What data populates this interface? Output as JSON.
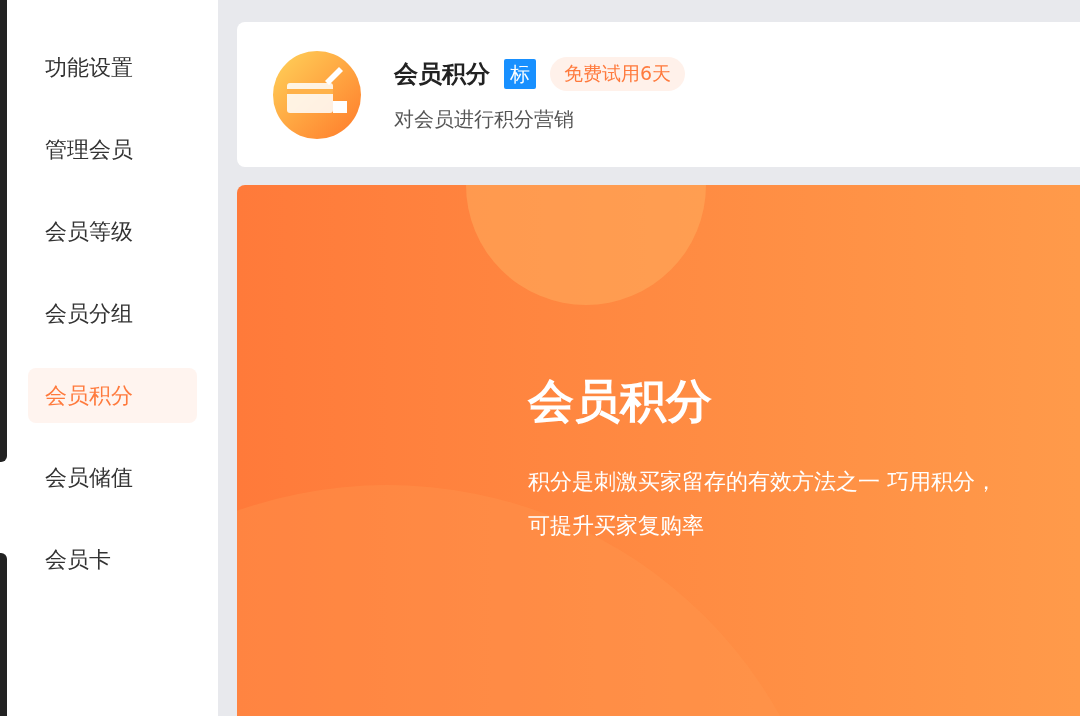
{
  "sidebar": {
    "items": [
      {
        "label": "功能设置",
        "selected": false
      },
      {
        "label": "管理会员",
        "selected": false
      },
      {
        "label": "会员等级",
        "selected": false
      },
      {
        "label": "会员分组",
        "selected": false
      },
      {
        "label": "会员积分",
        "selected": true
      },
      {
        "label": "会员储值",
        "selected": false
      },
      {
        "label": "会员卡",
        "selected": false
      }
    ]
  },
  "header": {
    "title": "会员积分",
    "tag": "标",
    "badge": "免费试用6天",
    "subtitle": "对会员进行积分营销"
  },
  "banner": {
    "title": "会员积分",
    "description": "积分是刺激买家留存的有效方法之一 巧用积分，可提升买家复购率"
  }
}
